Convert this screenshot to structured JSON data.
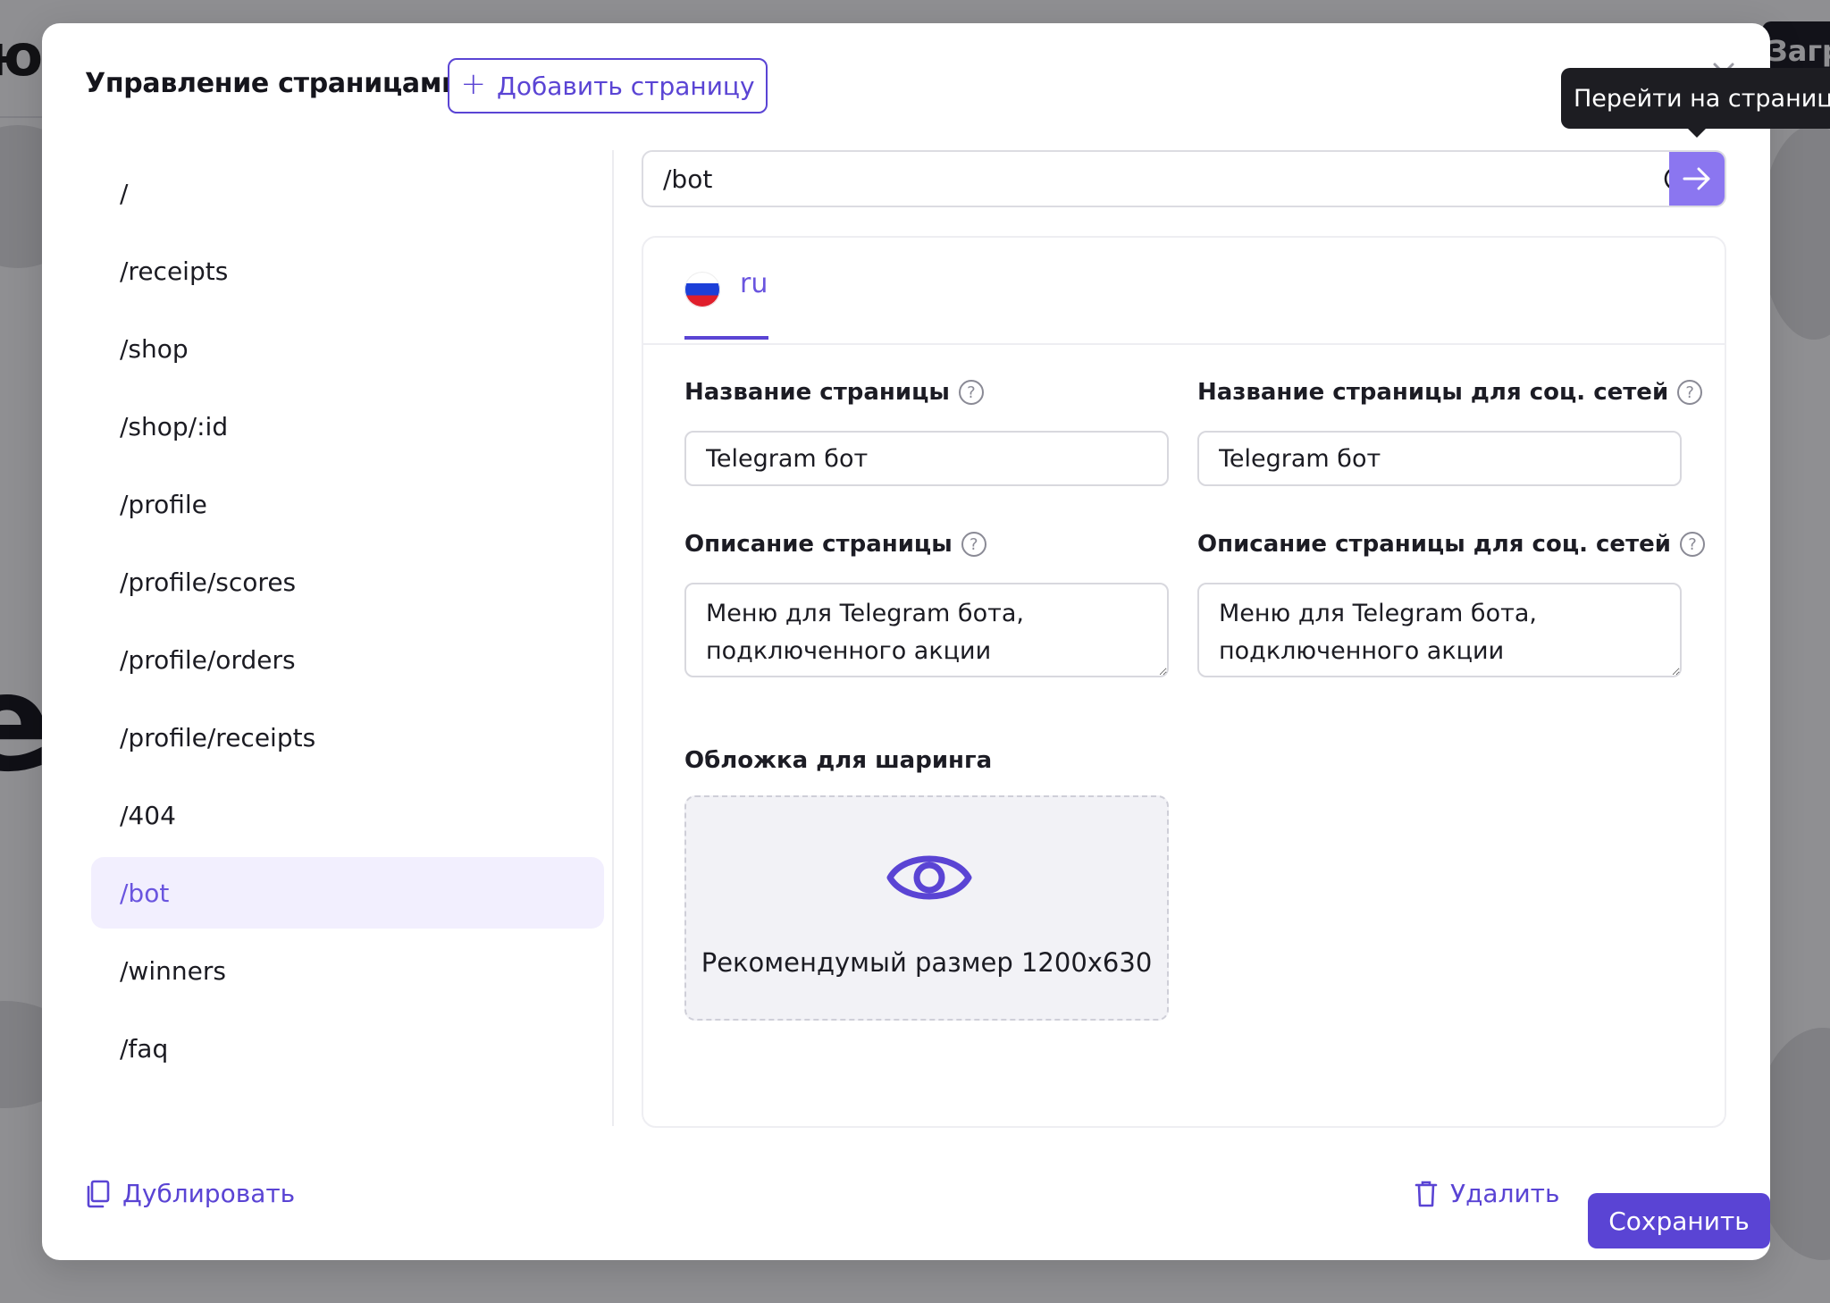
{
  "background": {
    "logo_fragment": "ю",
    "load_button_fragment": "Загр",
    "big_letters": [
      "E",
      "e"
    ]
  },
  "modal": {
    "title": "Управление страницами",
    "add_page_label": "Добавить страницу",
    "tooltip": "Перейти на страницу"
  },
  "routes": [
    "/",
    "/receipts",
    "/shop",
    "/shop/:id",
    "/profile",
    "/profile/scores",
    "/profile/orders",
    "/profile/receipts",
    "/404",
    "/bot",
    "/winners",
    "/faq"
  ],
  "selected_route": "/bot",
  "url_bar": {
    "value": "/bot"
  },
  "language_tab": {
    "code": "ru"
  },
  "form": {
    "page_title_label": "Название страницы",
    "page_title_value": "Telegram бот",
    "social_title_label": "Название страницы для соц. сетей",
    "social_title_value": "Telegram бот",
    "page_desc_label": "Описание страницы",
    "page_desc_value": "Меню для Telegram бота, подключенного акции",
    "social_desc_label": "Описание страницы для соц. сетей",
    "social_desc_value": "Меню для Telegram бота, подключенного акции",
    "cover_label": "Обложка для шаринга",
    "cover_hint": "Рекомендумый размер 1200x630",
    "help_glyph": "?"
  },
  "footer": {
    "duplicate_label": "Дублировать",
    "delete_label": "Удалить",
    "save_label": "Сохранить"
  },
  "colors": {
    "accent": "#5a44d4",
    "accent_light": "#8b76f0",
    "selected_bg": "#f2effe"
  }
}
